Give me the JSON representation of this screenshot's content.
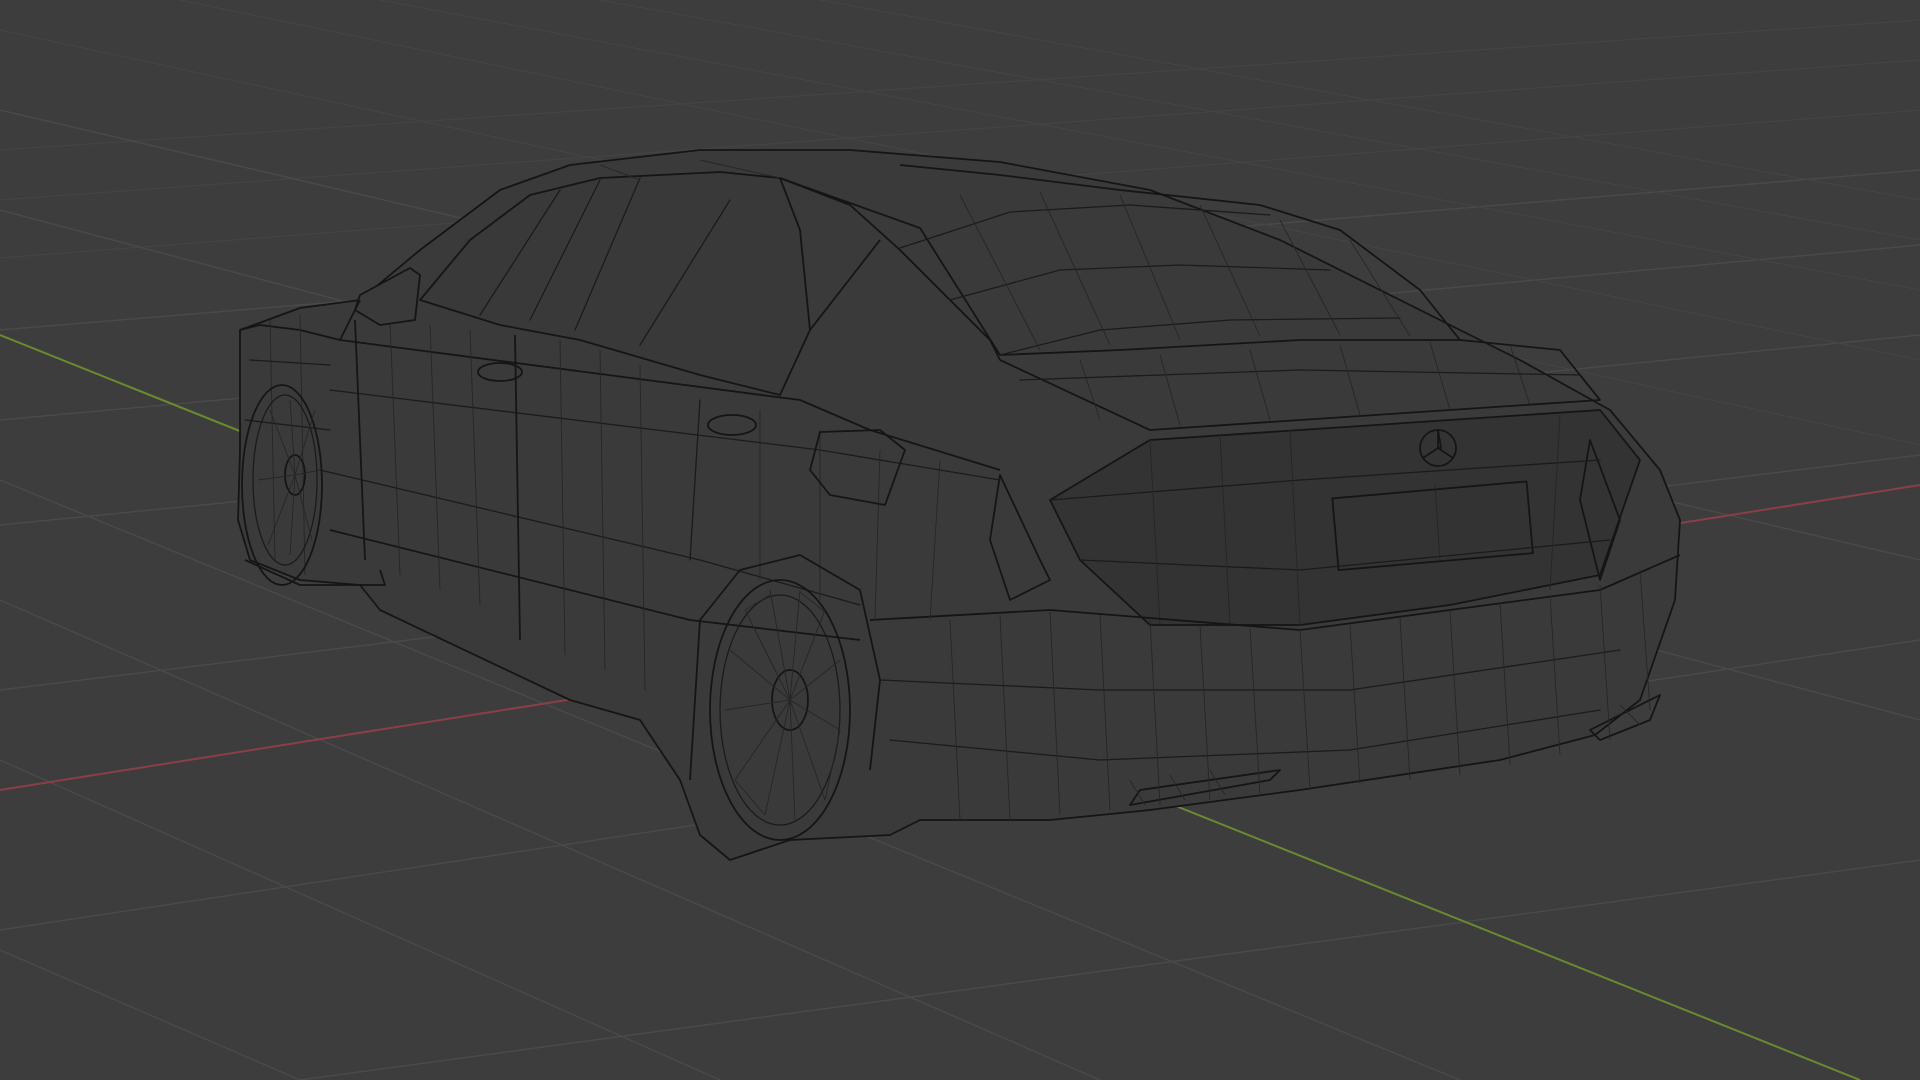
{
  "viewport": {
    "background": "#3d3d3d",
    "grid_color": "#4a4a4a",
    "wire_color": "#1b1b1b",
    "axis_x_color": "#8a3f48",
    "axis_y_color": "#6a8a2f"
  },
  "object": {
    "type": "car-wireframe",
    "emblem": "three-pointed-star-icon"
  }
}
